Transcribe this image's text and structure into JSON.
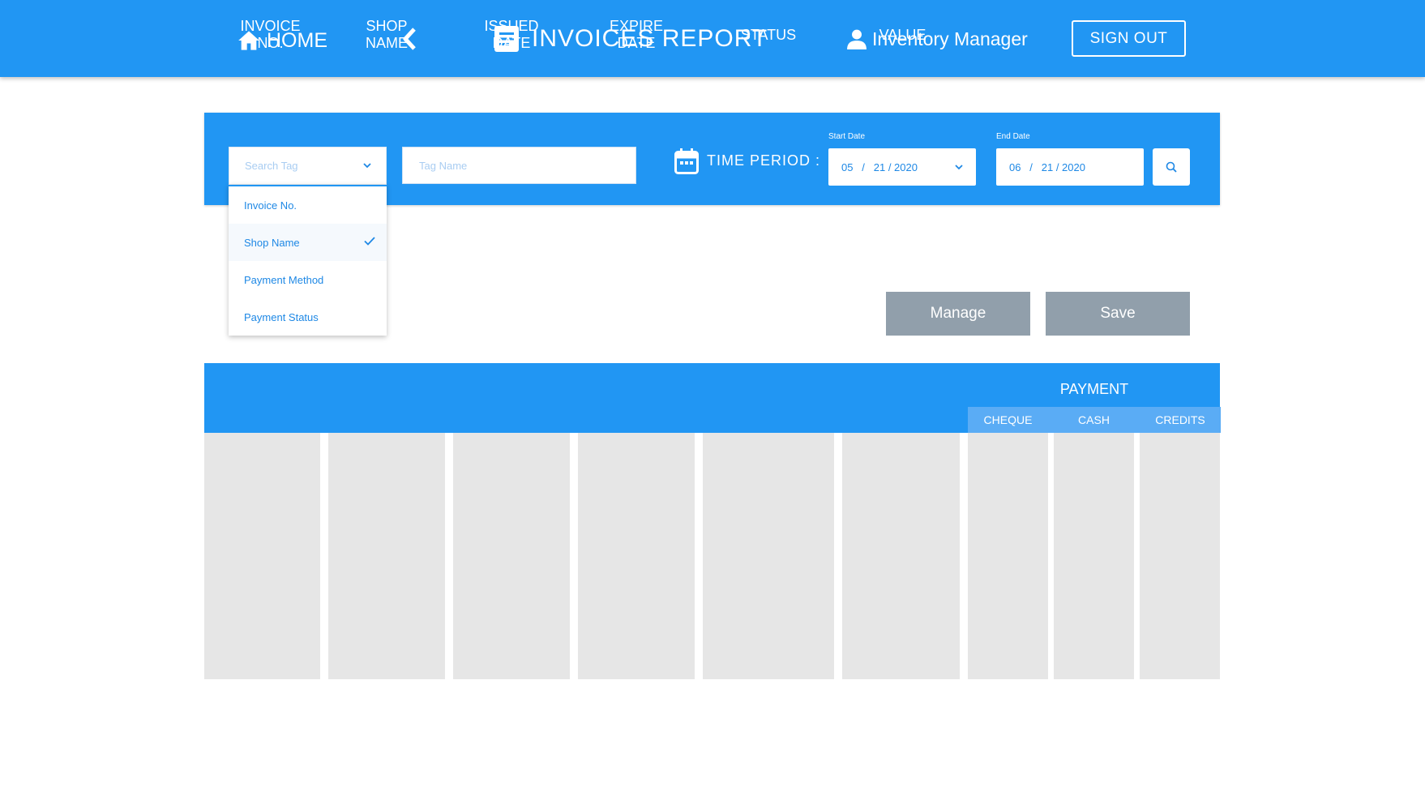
{
  "header": {
    "home_label": "HOME",
    "title": "INVOICES REPORT",
    "user_name": "Inventory Manager",
    "signout_label": "SIGN OUT"
  },
  "filter": {
    "search_tag_placeholder": "Search Tag",
    "tag_name_placeholder": "Tag Name",
    "time_period_label": "TIME PERIOD :",
    "start_date_label": "Start Date",
    "start_date_value": "05   /   21 / 2020",
    "end_date_label": "End Date",
    "end_date_value": "06   /   21 / 2020"
  },
  "dropdown": {
    "items": [
      "Invoice No.",
      "Shop Name",
      "Payment Method",
      "Payment Status"
    ],
    "selected": "Shop Name"
  },
  "actions": {
    "manage_label": "Manage",
    "save_label": "Save"
  },
  "table": {
    "col_invoice_1": "INVOICE",
    "col_invoice_2": "NO.",
    "col_shop_1": "SHOP",
    "col_shop_2": "NAME",
    "col_issued_1": "ISSUED",
    "col_issued_2": "DATE",
    "col_expire_1": "EXPIRE",
    "col_expire_2": "DATE",
    "col_status": "STATUS",
    "col_value": "VALUE",
    "col_payment": "PAYMENT",
    "sub_cheque": "CHEQUE",
    "sub_cash": "CASH",
    "sub_credits": "CREDITS"
  },
  "colors": {
    "primary": "#2196f3",
    "button_grey": "#919fab",
    "cell_grey": "#e6e6e6"
  },
  "icons": [
    "home-icon",
    "chevron-left-icon",
    "document-icon",
    "user-icon",
    "calendar-icon",
    "chevron-down-icon",
    "search-icon",
    "check-icon"
  ]
}
